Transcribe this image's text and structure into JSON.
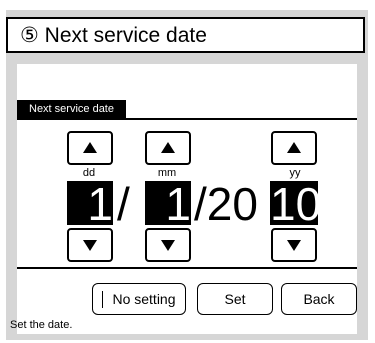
{
  "title": "⑤ Next service date",
  "section_label": "Next service date",
  "date": {
    "day": {
      "label": "dd",
      "value": "1"
    },
    "month": {
      "label": "mm",
      "value": "1"
    },
    "year": {
      "label": "yy",
      "prefix": "/20",
      "value": "10"
    },
    "separator": "/"
  },
  "buttons": {
    "no_setting": "No setting",
    "set": "Set",
    "back": "Back"
  },
  "status": "Set the date.",
  "icons": [
    "up-arrow-icon",
    "down-arrow-icon"
  ]
}
